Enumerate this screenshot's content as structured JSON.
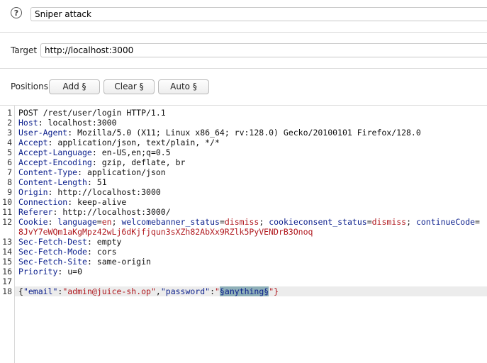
{
  "attack": {
    "type_value": "Sniper attack"
  },
  "target": {
    "label": "Target",
    "value": "http://localhost:3000"
  },
  "positions": {
    "label": "Positions",
    "add_label": "Add §",
    "clear_label": "Clear §",
    "auto_label": "Auto §"
  },
  "request": {
    "line_numbers": [
      "1",
      "2",
      "3",
      "4",
      "5",
      "6",
      "7",
      "8",
      "9",
      "10",
      "11",
      "12",
      "13",
      "14",
      "15",
      "16",
      "17",
      "18"
    ],
    "request_line": "POST /rest/user/login HTTP/1.1",
    "headers": [
      {
        "name": "Host",
        "value": "localhost:3000"
      },
      {
        "name": "User-Agent",
        "value": "Mozilla/5.0 (X11; Linux x86_64; rv:128.0) Gecko/20100101 Firefox/128.0"
      },
      {
        "name": "Accept",
        "value": "application/json, text/plain, */*"
      },
      {
        "name": "Accept-Language",
        "value": "en-US,en;q=0.5"
      },
      {
        "name": "Accept-Encoding",
        "value": "gzip, deflate, br"
      },
      {
        "name": "Content-Type",
        "value": "application/json"
      },
      {
        "name": "Content-Length",
        "value": "51"
      },
      {
        "name": "Origin",
        "value": "http://localhost:3000"
      },
      {
        "name": "Connection",
        "value": "keep-alive"
      },
      {
        "name": "Referer",
        "value": "http://localhost:3000/"
      }
    ],
    "cookie": {
      "name": "Cookie",
      "c1_name": "language",
      "c1_val": "en",
      "c2_name": "welcomebanner_status",
      "c2_val": "dismiss",
      "c3_name": "cookieconsent_status",
      "c3_val": "dismiss",
      "c4_name": "continueCode",
      "c4_val": "8JvY7eWQm1aKgMpz42wLj6dKjfjqun3sXZh82AbXx9RZlk5PyVENDrB3Onoq"
    },
    "headers2": [
      {
        "name": "Sec-Fetch-Dest",
        "value": "empty"
      },
      {
        "name": "Sec-Fetch-Mode",
        "value": "cors"
      },
      {
        "name": "Sec-Fetch-Site",
        "value": "same-origin"
      },
      {
        "name": "Priority",
        "value": "u=0"
      }
    ],
    "body": {
      "open": "{",
      "key1": "\"email\"",
      "val1": "\"admin@juice-sh.op\"",
      "key2": "\"password\"",
      "quote": "\"",
      "payload": "§anything§",
      "close": "\"}"
    }
  }
}
